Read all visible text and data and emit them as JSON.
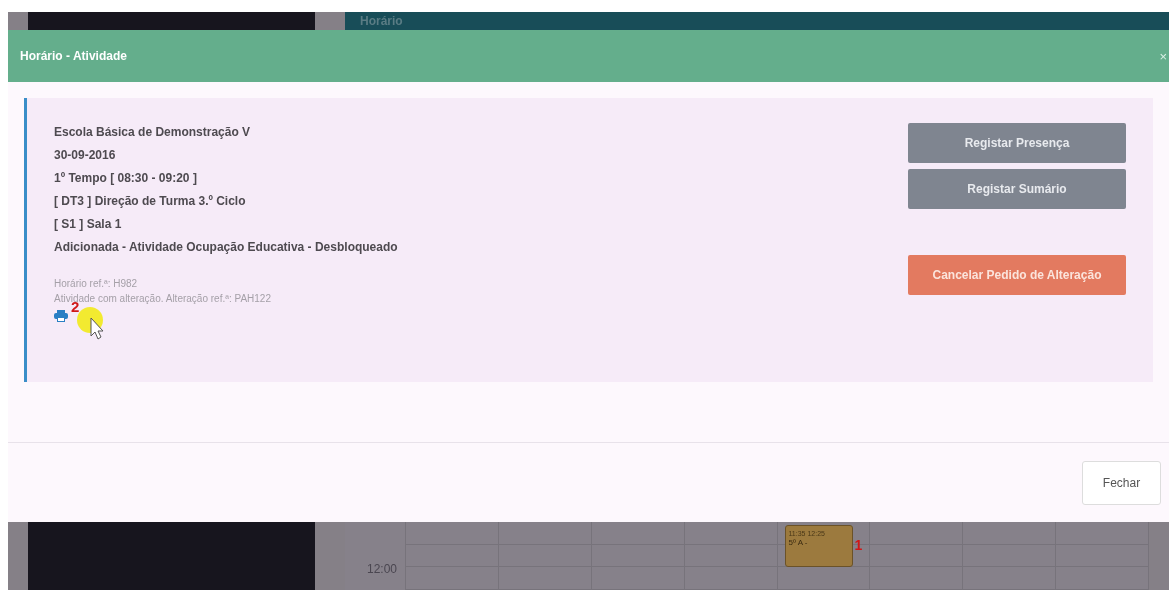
{
  "background": {
    "header_title": "Horário",
    "time_label": "12:00",
    "event": {
      "time": "11:35 12:25",
      "label": "5º A -",
      "annotation": "1"
    }
  },
  "modal": {
    "title": "Horário - Atividade",
    "close": "×",
    "details": [
      "Escola Básica de Demonstração V",
      "30-09-2016",
      "1º Tempo [ 08:30 - 09:20 ]",
      "[ DT3 ] Direção de Turma 3.º Ciclo",
      "[ S1 ] Sala 1",
      "Adicionada - Atividade Ocupação Educativa - Desbloqueado"
    ],
    "references": [
      "Horário ref.ª: H982",
      "Atividade com alteração. Alteração ref.ª: PAH122"
    ],
    "print_annotation": "2",
    "actions": [
      {
        "label": "Registar Presença",
        "kind": "secondary"
      },
      {
        "label": "Registar Sumário",
        "kind": "secondary"
      },
      {
        "label": "Cancelar Pedido de Alteração",
        "kind": "danger"
      }
    ],
    "footer_button": "Fechar"
  }
}
